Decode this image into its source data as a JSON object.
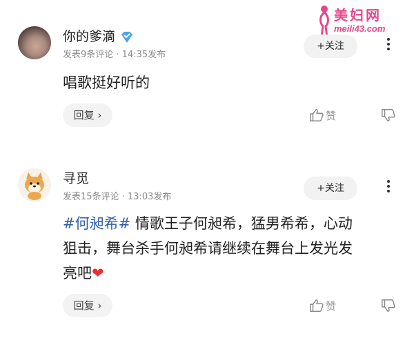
{
  "watermark": {
    "title": "美妇网",
    "url": "meili43.com"
  },
  "comments": [
    {
      "username": "你的爹滴",
      "verified": true,
      "meta": "发表9条评论 · 14:35发布",
      "follow_label": "+关注",
      "text_parts": [
        "唱歌挺好听的"
      ],
      "reply_label": "回复 ›",
      "like_label": "赞"
    },
    {
      "username": "寻觅",
      "verified": false,
      "meta": "发表15条评论 · 13:03发布",
      "follow_label": "+关注",
      "hashtag": "#何昶希#",
      "text_parts": [
        " 情歌王子何昶希，猛男希希，心动",
        "狙击，舞台杀手何昶希请继续在舞台上发光发",
        "亮吧"
      ],
      "reply_label": "回复 ›",
      "like_label": "赞"
    }
  ],
  "colors": {
    "hashtag": "#2f5da8",
    "watermark": "#e8468a",
    "heart": "#e8312f"
  }
}
